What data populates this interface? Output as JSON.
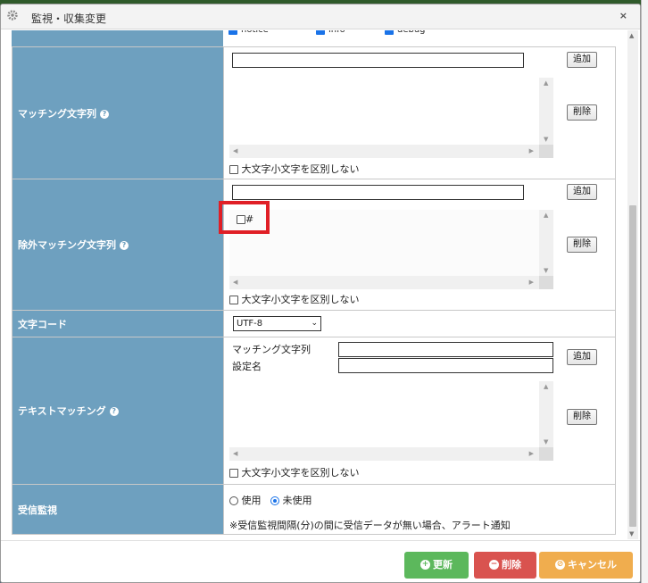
{
  "dialog": {
    "title": "監視・収集変更",
    "close": "×"
  },
  "top_partial": {
    "labels": [
      "notice",
      "info",
      "debug"
    ]
  },
  "matching": {
    "label": "マッチング文字列",
    "add": "追加",
    "delete": "削除",
    "case": "大文字小文字を区別しない"
  },
  "exclude": {
    "label": "除外マッチング文字列",
    "item": "#",
    "add": "追加",
    "delete": "削除",
    "case": "大文字小文字を区別しない"
  },
  "charset": {
    "label": "文字コード",
    "value": "UTF-8"
  },
  "text_matching": {
    "label": "テキストマッチング",
    "field1": "マッチング文字列",
    "field2": "設定名",
    "add": "追加",
    "delete": "削除",
    "case": "大文字小文字を区別しない"
  },
  "receive": {
    "label": "受信監視",
    "opt_use": "使用",
    "opt_unused": "未使用",
    "selected": "未使用",
    "note": "※受信監視間隔(分)の間に受信データが無い場合、アラート通知"
  },
  "footer": {
    "update": "更新",
    "delete": "削除",
    "cancel": "キャンセル"
  },
  "colors": {
    "label_bg": "#6ea0bf",
    "update": "#5cb85c",
    "delete": "#d9534f",
    "cancel": "#f0ad4e",
    "highlight": "#e01f26"
  }
}
